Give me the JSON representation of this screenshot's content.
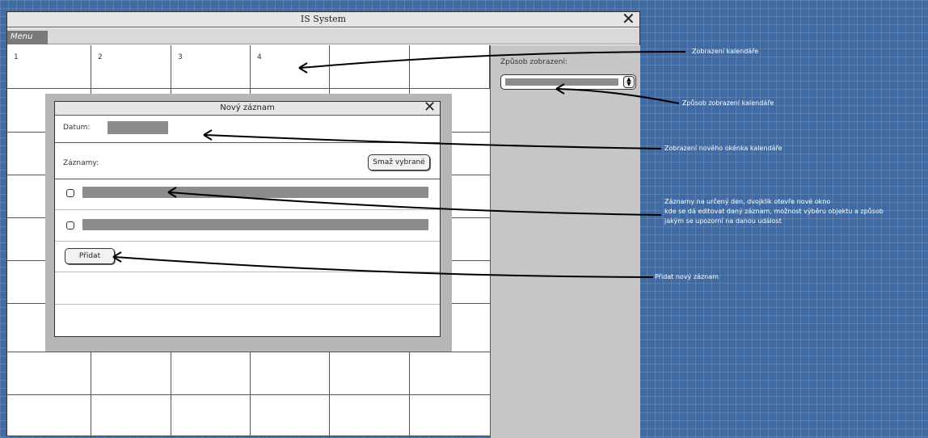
{
  "window": {
    "title": "IS System"
  },
  "menu": {
    "label": "Menu"
  },
  "calendar": {
    "day_labels": [
      "1",
      "2",
      "3",
      "4"
    ]
  },
  "side_panel": {
    "display_mode_label": "Způsob zobrazení:"
  },
  "modal": {
    "title": "Nový záznam",
    "date_label": "Datum:",
    "records_label": "Záznamy:",
    "delete_selected_label": "Smaž vybrané",
    "add_label": "Přidat"
  },
  "annotations": {
    "calendar_view": "Zobrazení kalendáře",
    "display_mode": "Způsob zobrazení kalendáře",
    "new_window": "Zobrazení nového okénka kalendáře",
    "records_line1": "Záznamy na určený den, dvojklik otevře nové okno",
    "records_line2": "kde se dá editovat daný záznam, možnost výběru objektu a způsob",
    "records_line3": "jakým se upozorní na danou událost",
    "add_record": "Přidat nový záznam"
  }
}
